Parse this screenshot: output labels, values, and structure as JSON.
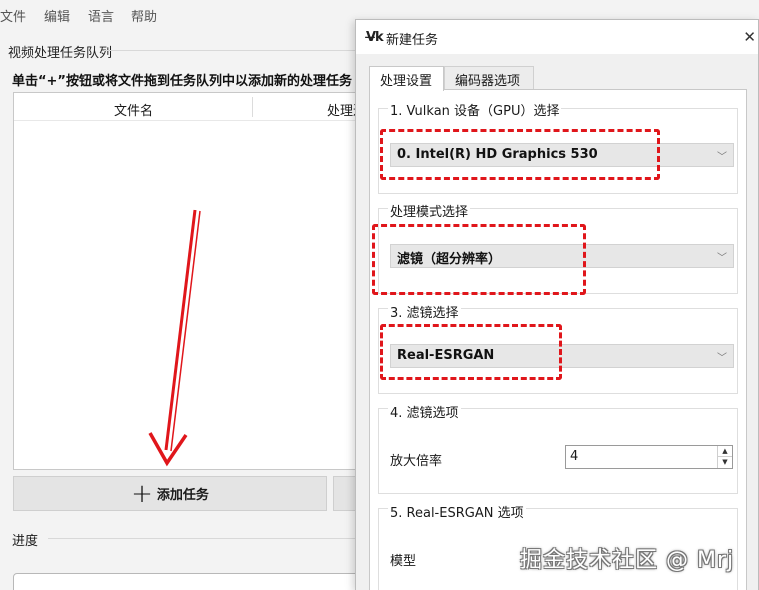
{
  "menu": {
    "file": "文件",
    "edit": "编辑",
    "language": "语言",
    "help": "帮助"
  },
  "queue": {
    "title": "视频处理任务队列",
    "hint": "单击“+”按钮或将文件拖到任务队列中以添加新的处理任务",
    "columns": {
      "filename": "文件名",
      "progress": "处理进度"
    }
  },
  "buttons": {
    "add_task_plus": "+",
    "add_task": "添加任务"
  },
  "progress": {
    "title": "进度"
  },
  "dialog": {
    "logo": "V̶k",
    "title": "新建任务",
    "close": "✕",
    "tabs": {
      "process": "处理设置",
      "encoder": "编码器选项"
    },
    "groups": {
      "vulkan": {
        "title": "1. Vulkan 设备（GPU）选择",
        "value": "0. Intel(R) HD Graphics 530"
      },
      "mode": {
        "title": "处理模式选择",
        "value": "滤镜（超分辨率）"
      },
      "filter": {
        "title": "3. 滤镜选择",
        "value": "Real-ESRGAN"
      },
      "filter_options": {
        "title": "4. 滤镜选项",
        "scale_label": "放大倍率",
        "scale_value": "4"
      },
      "esrgan": {
        "title": "5. Real-ESRGAN 选项",
        "model_label": "模型"
      }
    }
  },
  "watermark": "掘金技术社区 @ Mrj",
  "colors": {
    "highlight": "#e0161b",
    "arrow": "#e0161b"
  }
}
